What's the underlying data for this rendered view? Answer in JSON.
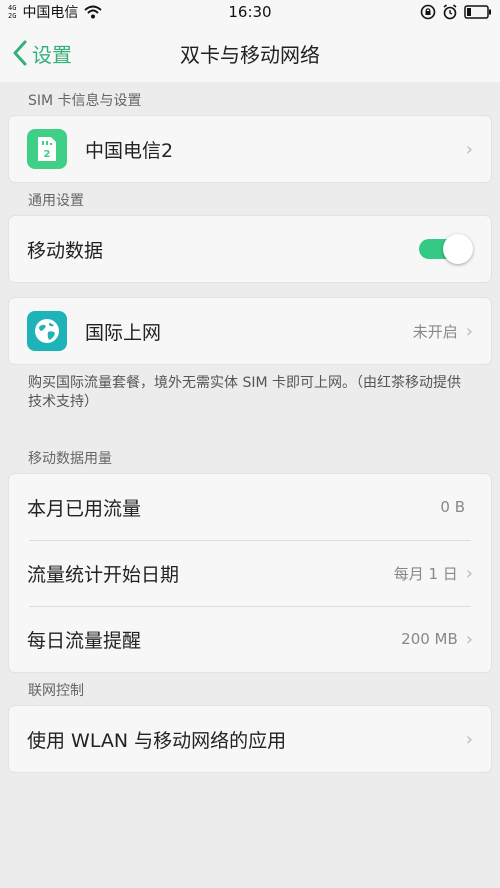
{
  "status_bar": {
    "signal_top": "4G",
    "signal_bottom": "2G",
    "carrier": "中国电信",
    "time": "16:30"
  },
  "nav": {
    "back_label": "设置",
    "title": "双卡与移动网络"
  },
  "sections": {
    "sim": {
      "label": "SIM 卡信息与设置",
      "sim_name": "中国电信2",
      "sim_badge": "2"
    },
    "general": {
      "label": "通用设置",
      "mobile_data_label": "移动数据",
      "mobile_data_on": true,
      "intl_label": "国际上网",
      "intl_value": "未开启",
      "note": "购买国际流量套餐，境外无需实体 SIM 卡即可上网。（由红茶移动提供技术支持）"
    },
    "usage": {
      "label": "移动数据用量",
      "rows": [
        {
          "label": "本月已用流量",
          "value": "0 B"
        },
        {
          "label": "流量统计开始日期",
          "value": "每月 1 日"
        },
        {
          "label": "每日流量提醒",
          "value": "200 MB"
        }
      ]
    },
    "network_control": {
      "label": "联网控制",
      "apps_label": "使用 WLAN 与移动网络的应用"
    }
  },
  "colors": {
    "accent": "#35b07a",
    "toggle_on": "#35c986",
    "sim_icon": "#3fcf86",
    "globe_icon": "#1db3b9"
  }
}
